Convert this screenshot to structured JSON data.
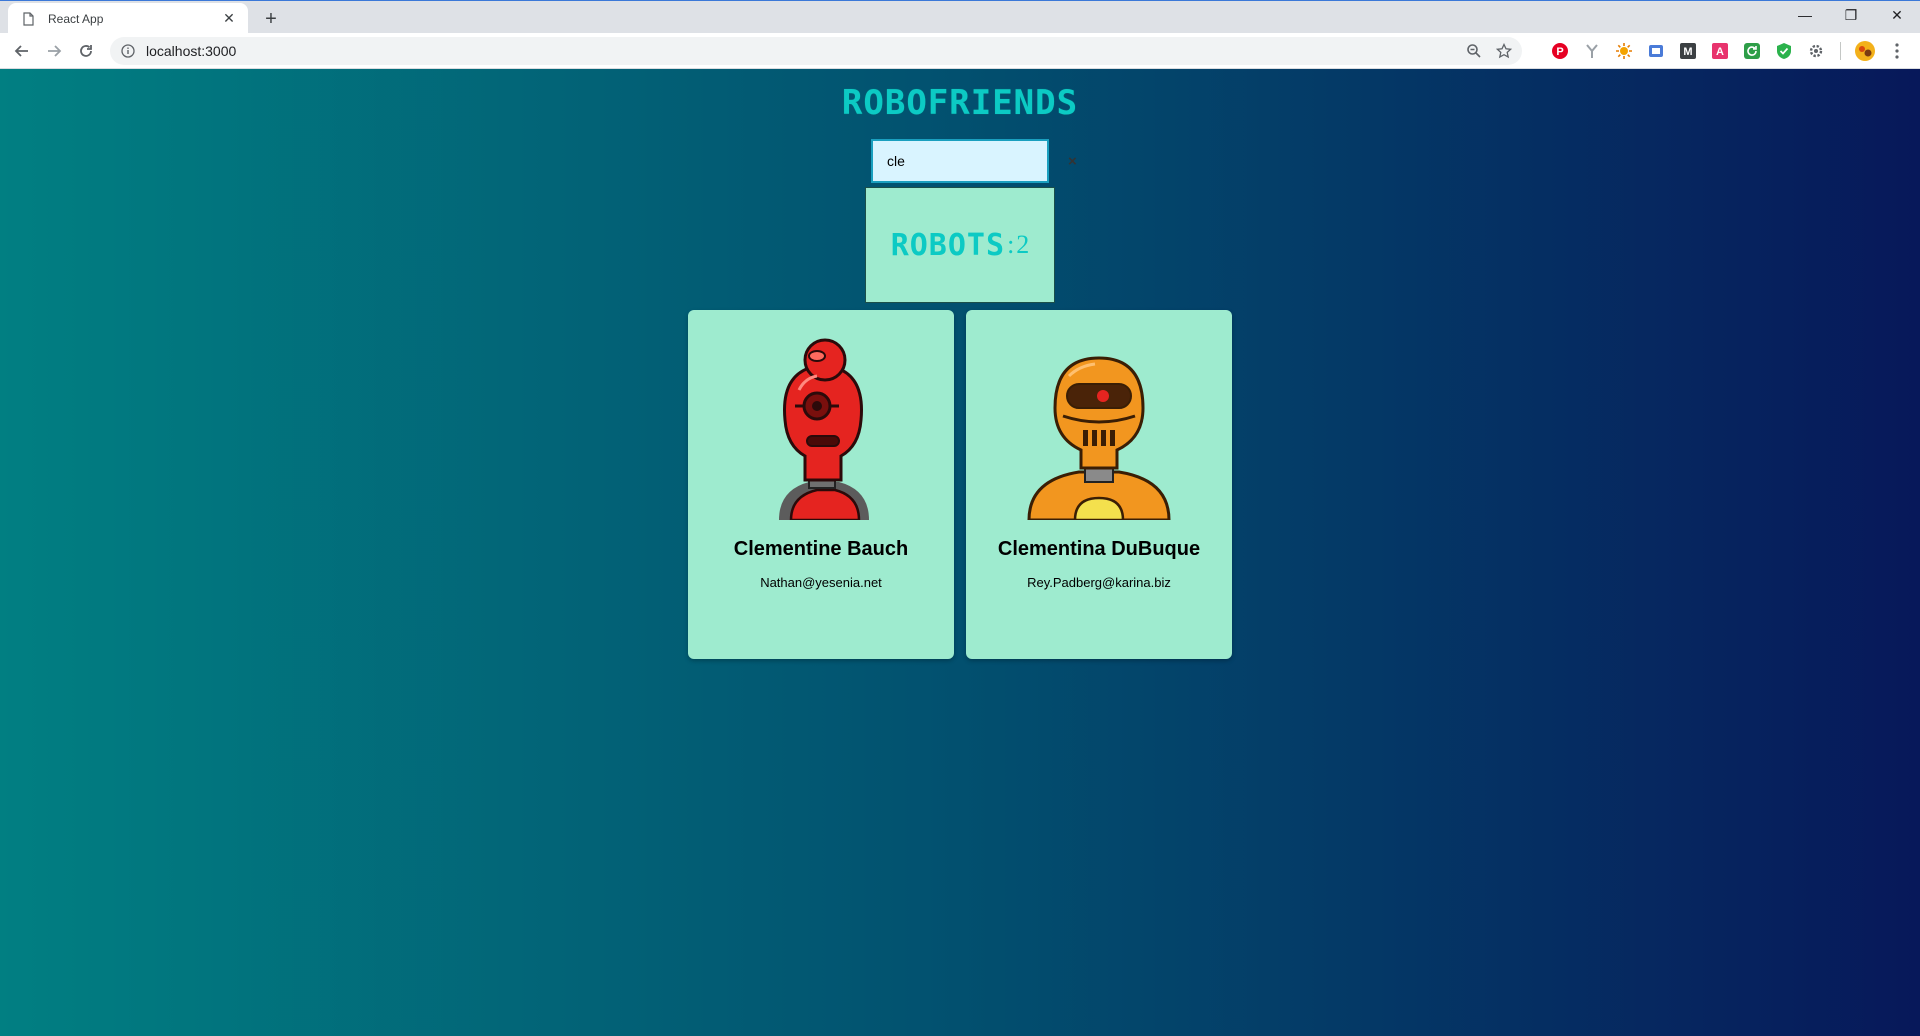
{
  "browser": {
    "tab_title": "React App",
    "tab_close": "✕",
    "new_tab": "+",
    "url": "localhost:3000",
    "window_controls": [
      "—",
      "❐",
      "✕"
    ],
    "extensions": [
      {
        "name": "pinterest-extension",
        "glyph": "P",
        "color": "#e60023"
      },
      {
        "name": "broom-extension",
        "glyph": "Y",
        "color": "#9aa0a6"
      },
      {
        "name": "sun-extension",
        "glyph": "✹",
        "color": "#f4a300"
      },
      {
        "name": "blue-extension",
        "glyph": "⬛",
        "color": "#4a7bd8"
      },
      {
        "name": "m-extension",
        "glyph": "M",
        "color": "#3c4043"
      },
      {
        "name": "a-extension",
        "glyph": "A",
        "color": "#e8336d"
      },
      {
        "name": "green-sync-extension",
        "glyph": "⟳",
        "color": "#2e9e48"
      },
      {
        "name": "shield-extension",
        "glyph": "✔",
        "color": "#2bb24c"
      },
      {
        "name": "gear-extension",
        "glyph": "⚙",
        "color": "#5f6368"
      }
    ]
  },
  "app": {
    "title": "ROBOFRIENDS",
    "search": {
      "value": "cle",
      "clear": "×"
    },
    "count": {
      "label": "ROBOTS",
      "separator": ":",
      "value": "2"
    },
    "robots": [
      {
        "name": "Clementine Bauch",
        "email": "Nathan@yesenia.net",
        "color": "#e52420"
      },
      {
        "name": "Clementina DuBuque",
        "email": "Rey.Padberg@karina.biz",
        "color": "#f2961f"
      }
    ]
  }
}
